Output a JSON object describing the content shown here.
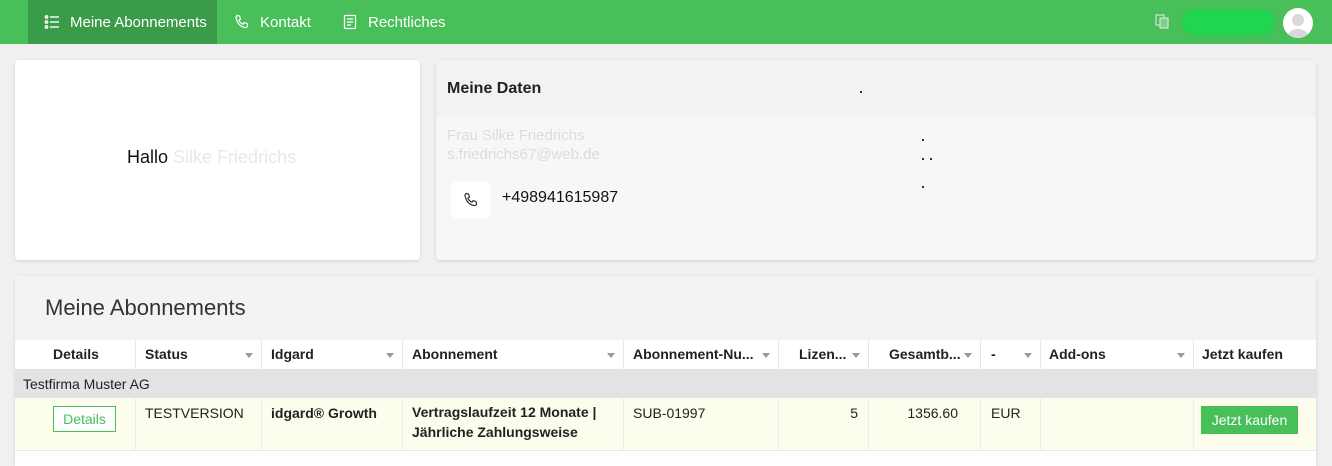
{
  "nav": {
    "items": [
      {
        "label": "Meine Abonnements",
        "icon": "list-icon"
      },
      {
        "label": "Kontakt",
        "icon": "phone-icon"
      },
      {
        "label": "Rechtliches",
        "icon": "document-icon"
      }
    ]
  },
  "hello": {
    "greeting": "Hallo",
    "name": "Silke Friedrichs"
  },
  "my_data": {
    "title": "Meine Daten",
    "name_line": "Frau Silke Friedrichs",
    "email_line": "s.friedrichs67@web.de",
    "phone": "+498941615987"
  },
  "subscriptions": {
    "title": "Meine Abonnements",
    "columns": [
      "Details",
      "Status",
      "Idgard",
      "Abonnement",
      "Abonnement-Nu...",
      "Lizen...",
      "Gesamtb...",
      "-",
      "Add-ons",
      "Jetzt kaufen"
    ],
    "group": "Testfirma Muster AG",
    "row": {
      "details_button": "Details",
      "status": "TESTVERSION",
      "idgard": "idgard® Growth",
      "abonnement_line1": "Vertragslaufzeit 12 Monate |",
      "abonnement_line2": "Jährliche Zahlungsweise",
      "number": "SUB-01997",
      "licenses": "5",
      "total": "1356.60",
      "currency": "EUR",
      "addons": "",
      "buy_button": "Jetzt kaufen"
    }
  },
  "colors": {
    "brand_green": "#48bf59",
    "nav_active": "#3a9b48"
  }
}
